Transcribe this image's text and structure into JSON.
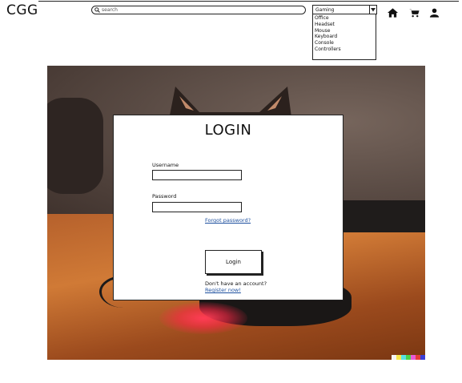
{
  "header": {
    "logo": "CGG",
    "search": {
      "placeholder": "search"
    },
    "category_select": {
      "selected": "Gaming",
      "options": [
        "Office",
        "Headset",
        "Mouse",
        "Keyboard",
        "Console",
        "Controllers"
      ]
    },
    "icons": [
      "home-icon",
      "cart-icon",
      "user-icon"
    ]
  },
  "login": {
    "title": "LOGIN",
    "username_label": "Username",
    "username_value": "",
    "password_label": "Password",
    "password_value": "",
    "forgot_link": "Forgot password?",
    "submit_label": "Login",
    "no_account_text": "Don't have an account?",
    "register_link": "Register now!"
  },
  "colors": {
    "link": "#1d4f9e",
    "border": "#222222",
    "background": "#ffffff"
  }
}
